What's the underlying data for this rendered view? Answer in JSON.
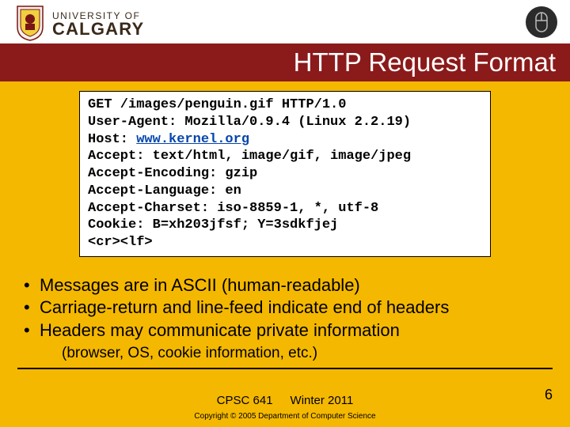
{
  "header": {
    "university_top": "UNIVERSITY OF",
    "university_bottom": "CALGARY"
  },
  "title": "HTTP Request Format",
  "code": {
    "l1a": "GET /images/penguin.gif HTTP/1.0",
    "l2a": "User-Agent: Mozilla/0.9.4 (Linux 2.2.19)",
    "l3a": "Host: ",
    "l3link": "www.kernel.org",
    "l4a": "Accept: text/html, image/gif, image/jpeg",
    "l5a": "Accept-Encoding: gzip",
    "l6a": "Accept-Language: en",
    "l7a": "Accept-Charset: iso-8859-1, *, utf-8",
    "l8a": "Cookie: B=xh203jfsf; Y=3sdkfjej",
    "l9a": "<cr><lf>"
  },
  "bullets": {
    "b1": "Messages are in ASCII (human-readable)",
    "b2": "Carriage-return and line-feed indicate end of headers",
    "b3": "Headers may communicate private information",
    "sub": "(browser, OS, cookie information, etc.)"
  },
  "footer": {
    "course": "CPSC 641",
    "term": "Winter 2011",
    "copyright": "Copyright © 2005 Department of Computer Science",
    "page": "6"
  }
}
